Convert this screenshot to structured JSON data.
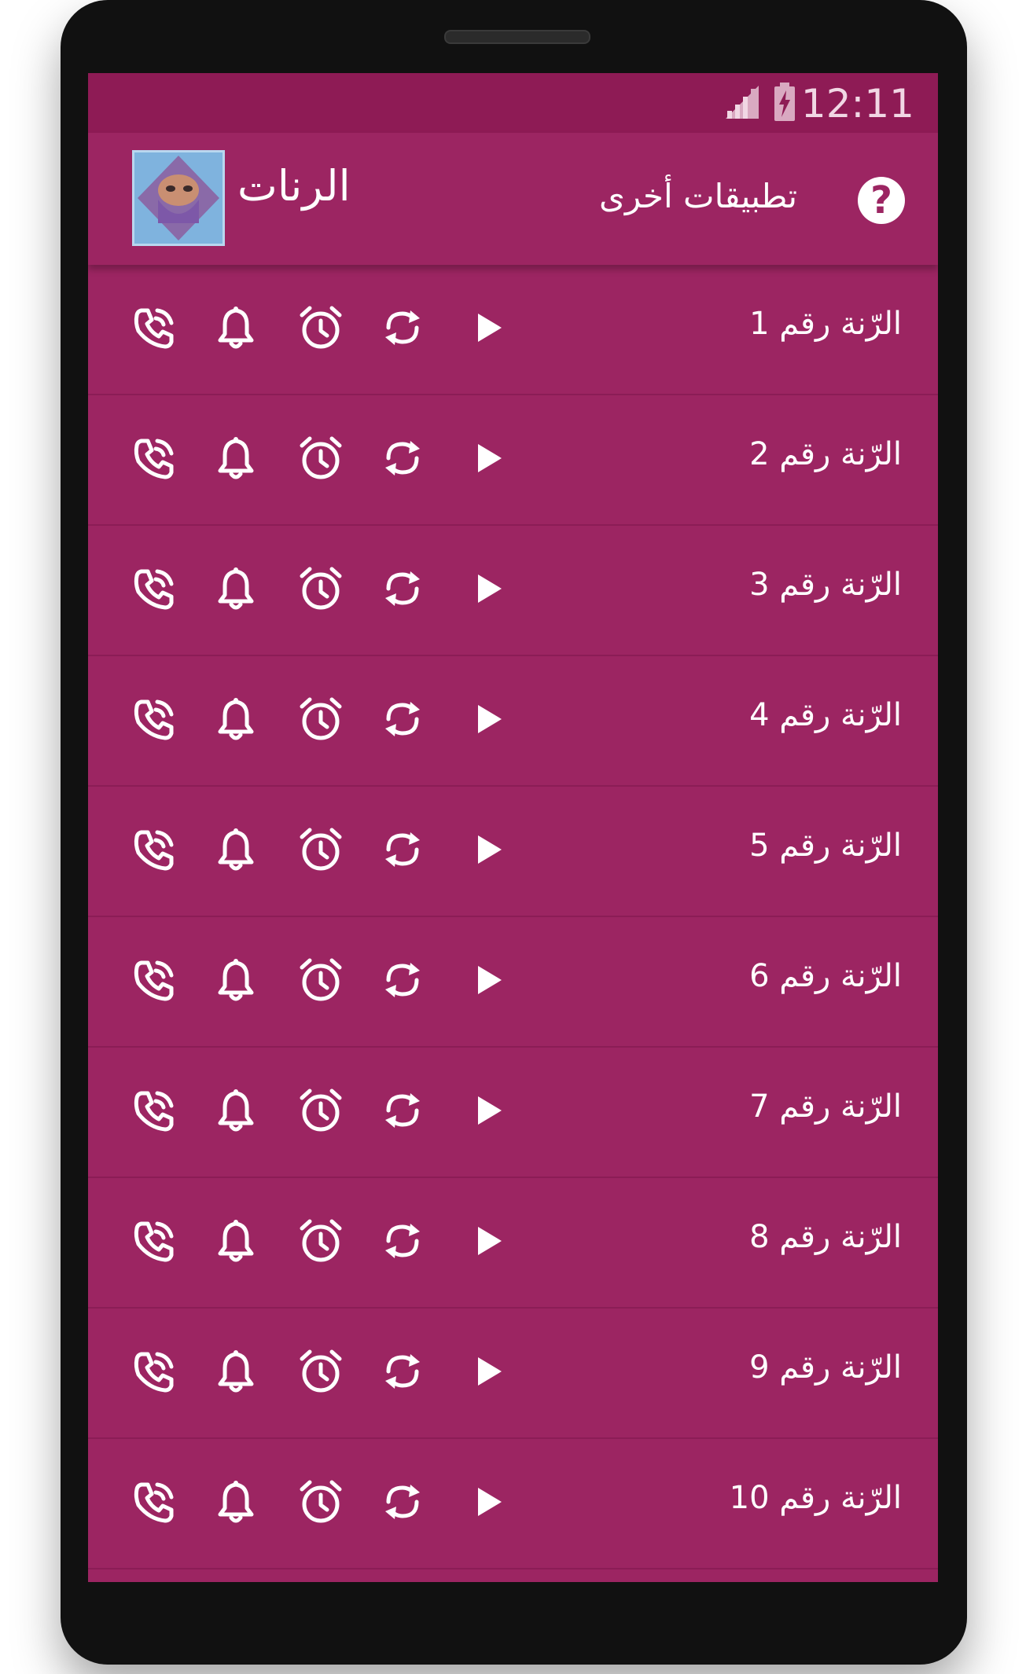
{
  "status_bar": {
    "time": "12:11"
  },
  "app_bar": {
    "title": "الرنات",
    "other_apps_label": "تطبيقات أخرى",
    "help_label": "?"
  },
  "ringtones": [
    {
      "label": "الرّنة رقم 1"
    },
    {
      "label": "الرّنة رقم 2"
    },
    {
      "label": "الرّنة رقم 3"
    },
    {
      "label": "الرّنة رقم 4"
    },
    {
      "label": "الرّنة رقم 5"
    },
    {
      "label": "الرّنة رقم 6"
    },
    {
      "label": "الرّنة رقم 7"
    },
    {
      "label": "الرّنة رقم 8"
    },
    {
      "label": "الرّنة رقم 9"
    },
    {
      "label": "الرّنة رقم 10"
    }
  ],
  "row_actions": [
    "ringtone-call-icon",
    "notification-bell-icon",
    "alarm-clock-icon",
    "sync-icon",
    "play-icon"
  ],
  "colors": {
    "primary": "#9c2562",
    "status_bar": "#8e1b55",
    "divider": "#8b1d56",
    "icon": "#ffffff"
  }
}
